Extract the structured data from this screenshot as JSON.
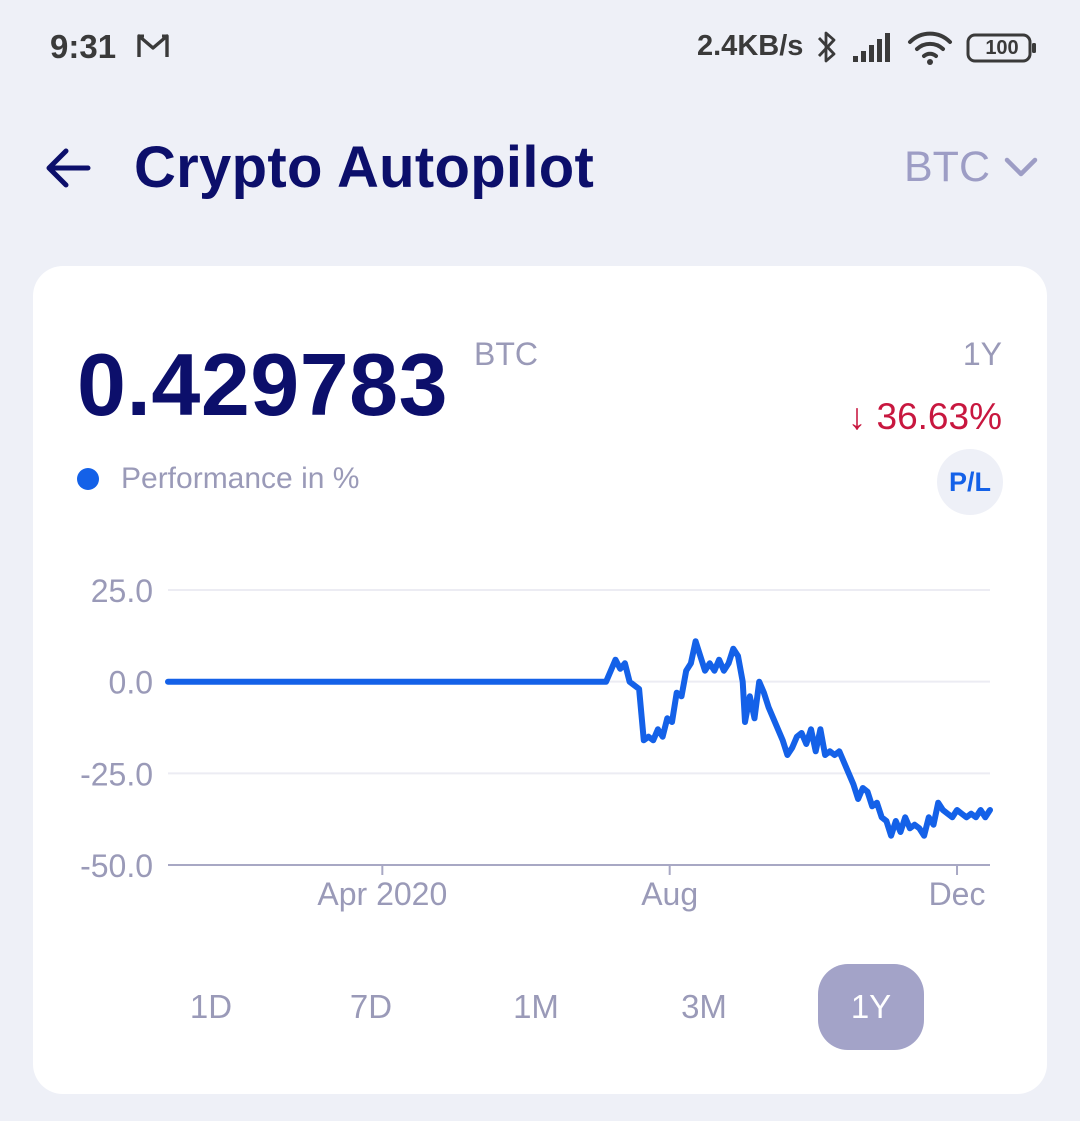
{
  "status_bar": {
    "time": "9:31",
    "speed": "2.4KB/s",
    "battery": "100"
  },
  "header": {
    "title": "Crypto Autopilot",
    "coin": "BTC",
    "title_color": "#0c0f6b"
  },
  "card": {
    "balance": "0.429783",
    "unit": "BTC",
    "period": "1Y",
    "change": "↓ 36.63%",
    "change_color": "#c8173f",
    "legend": "Performance in %",
    "pl_button": "P/L"
  },
  "chart_data": {
    "type": "line",
    "x_range": [
      "2020-01-01",
      "2020-12-15"
    ],
    "y_ticks": [
      "25.0",
      "0.0",
      "-25.0",
      "-50.0"
    ],
    "ylim": [
      -50,
      25
    ],
    "x_ticks": [
      {
        "label": "Apr 2020",
        "date": "2020-04-01"
      },
      {
        "label": "Aug",
        "date": "2020-08-01"
      },
      {
        "label": "Dec",
        "date": "2020-12-01"
      }
    ],
    "grid": true,
    "color": "#1461e8",
    "series": [
      {
        "name": "Performance in %",
        "points": [
          [
            "2020-01-01",
            0
          ],
          [
            "2020-03-01",
            0
          ],
          [
            "2020-05-01",
            0
          ],
          [
            "2020-07-05",
            0
          ],
          [
            "2020-07-09",
            6
          ],
          [
            "2020-07-11",
            3.5
          ],
          [
            "2020-07-13",
            5
          ],
          [
            "2020-07-15",
            0
          ],
          [
            "2020-07-19",
            -2
          ],
          [
            "2020-07-21",
            -16
          ],
          [
            "2020-07-23",
            -15
          ],
          [
            "2020-07-25",
            -16
          ],
          [
            "2020-07-27",
            -13
          ],
          [
            "2020-07-29",
            -15
          ],
          [
            "2020-07-31",
            -10
          ],
          [
            "2020-08-02",
            -11
          ],
          [
            "2020-08-04",
            -3
          ],
          [
            "2020-08-06",
            -4
          ],
          [
            "2020-08-08",
            3
          ],
          [
            "2020-08-10",
            5
          ],
          [
            "2020-08-12",
            11
          ],
          [
            "2020-08-14",
            7
          ],
          [
            "2020-08-16",
            3
          ],
          [
            "2020-08-18",
            5
          ],
          [
            "2020-08-20",
            3
          ],
          [
            "2020-08-22",
            6
          ],
          [
            "2020-08-24",
            3
          ],
          [
            "2020-08-26",
            5
          ],
          [
            "2020-08-28",
            9
          ],
          [
            "2020-08-30",
            7
          ],
          [
            "2020-09-01",
            0
          ],
          [
            "2020-09-02",
            -11
          ],
          [
            "2020-09-04",
            -4
          ],
          [
            "2020-09-06",
            -10
          ],
          [
            "2020-09-08",
            0
          ],
          [
            "2020-09-10",
            -3
          ],
          [
            "2020-09-12",
            -7
          ],
          [
            "2020-09-14",
            -10
          ],
          [
            "2020-09-16",
            -13
          ],
          [
            "2020-09-18",
            -16
          ],
          [
            "2020-09-20",
            -20
          ],
          [
            "2020-09-22",
            -18
          ],
          [
            "2020-09-24",
            -15
          ],
          [
            "2020-09-26",
            -14
          ],
          [
            "2020-09-28",
            -17
          ],
          [
            "2020-09-30",
            -13
          ],
          [
            "2020-10-02",
            -19
          ],
          [
            "2020-10-04",
            -13
          ],
          [
            "2020-10-06",
            -20
          ],
          [
            "2020-10-08",
            -19
          ],
          [
            "2020-10-10",
            -20
          ],
          [
            "2020-10-12",
            -19
          ],
          [
            "2020-10-14",
            -22
          ],
          [
            "2020-10-16",
            -25
          ],
          [
            "2020-10-18",
            -28
          ],
          [
            "2020-10-20",
            -32
          ],
          [
            "2020-10-22",
            -29
          ],
          [
            "2020-10-24",
            -30
          ],
          [
            "2020-10-26",
            -34
          ],
          [
            "2020-10-28",
            -33
          ],
          [
            "2020-10-30",
            -37
          ],
          [
            "2020-11-01",
            -38
          ],
          [
            "2020-11-03",
            -42
          ],
          [
            "2020-11-05",
            -38
          ],
          [
            "2020-11-07",
            -41
          ],
          [
            "2020-11-09",
            -37
          ],
          [
            "2020-11-11",
            -40
          ],
          [
            "2020-11-13",
            -39
          ],
          [
            "2020-11-15",
            -40
          ],
          [
            "2020-11-17",
            -42
          ],
          [
            "2020-11-19",
            -37
          ],
          [
            "2020-11-21",
            -39
          ],
          [
            "2020-11-23",
            -33
          ],
          [
            "2020-11-25",
            -35
          ],
          [
            "2020-11-27",
            -36
          ],
          [
            "2020-11-29",
            -37
          ],
          [
            "2020-12-01",
            -35
          ],
          [
            "2020-12-03",
            -36
          ],
          [
            "2020-12-05",
            -37
          ],
          [
            "2020-12-07",
            -36
          ],
          [
            "2020-12-09",
            -37
          ],
          [
            "2020-12-11",
            -35
          ],
          [
            "2020-12-13",
            -37
          ],
          [
            "2020-12-15",
            -35
          ]
        ]
      }
    ]
  },
  "range_tabs": [
    {
      "label": "1D",
      "active": false
    },
    {
      "label": "7D",
      "active": false
    },
    {
      "label": "1M",
      "active": false
    },
    {
      "label": "3M",
      "active": false
    },
    {
      "label": "1Y",
      "active": true
    }
  ]
}
